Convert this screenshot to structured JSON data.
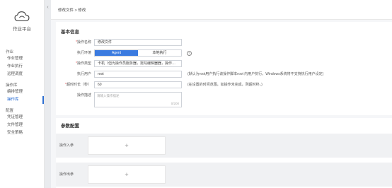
{
  "sidebar": {
    "app_name": "作业平台",
    "groups": [
      {
        "title": "作业",
        "items": [
          "作业管理",
          "作业执行",
          "远程调度"
        ]
      },
      {
        "title": "操作库",
        "items": [
          "编排管理",
          "操作库"
        ]
      },
      {
        "title": "配置",
        "items": [
          "凭证管理",
          "文件管理",
          "安全策略"
        ]
      }
    ],
    "active_item": "操作库"
  },
  "collapse_icon": "chevron-left",
  "breadcrumb": "修改文件 > 修改",
  "form": {
    "section_title": "基本信息",
    "name_label": "操作名称",
    "name_value": "修改文件",
    "exec_mode_label": "执行环境",
    "exec_mode_options": [
      "Agent",
      "本地执行"
    ],
    "exec_mode_selected": "Agent",
    "target_type_label": "操作类型",
    "target_type_value": "卡机（但为操作员服务器，需勾编辑器器，操作…",
    "exec_user_label": "执行用户",
    "exec_user_value": "root",
    "exec_user_hint": "(默认为root用户执行该操作脚本root 内用户执行，Windows系统将不支持执行用户设定)",
    "timeout_label": "超时时长（秒）",
    "timeout_value": "60",
    "timeout_hint": "(在设置的时间范围，如操作未完成，则超时终，)",
    "desc_label": "操作描述",
    "desc_placeholder": "请输入操作描述",
    "desc_counter": "0/200"
  },
  "params": {
    "section_title": "参数配置",
    "input_label": "操作入参",
    "output_label": "操作出参",
    "add_symbol": "+"
  }
}
